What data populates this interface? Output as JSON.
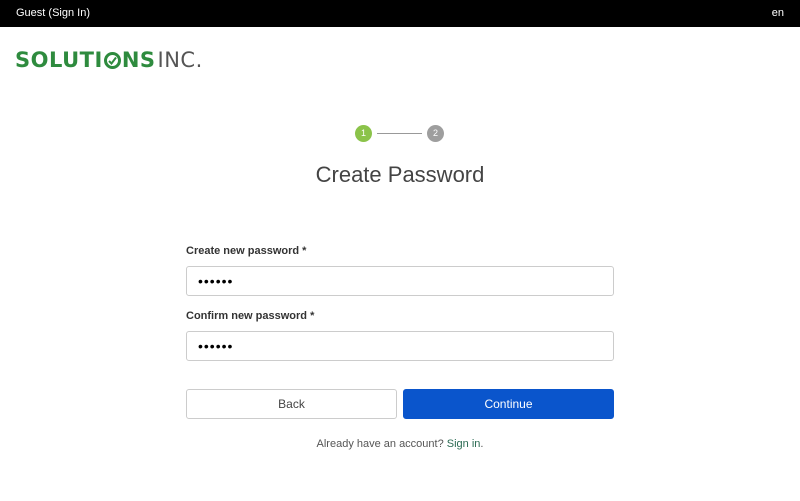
{
  "topbar": {
    "user": "Guest (Sign In)",
    "language": "en"
  },
  "logo": {
    "brand_left": "SOLUTI",
    "brand_right": "NS",
    "inc": "INC.",
    "color": "#2e8b3e"
  },
  "stepper": {
    "step1": "1",
    "step2": "2",
    "active_color": "#8bc34a",
    "inactive_color": "#9e9e9e"
  },
  "page": {
    "title": "Create Password"
  },
  "form": {
    "new_password_label": "Create new password",
    "new_password_value": "••••••",
    "confirm_password_label": "Confirm new password",
    "confirm_password_value": "••••••",
    "required_marker": "*"
  },
  "actions": {
    "back_label": "Back",
    "continue_label": "Continue",
    "primary_color": "#0a55cc"
  },
  "footer": {
    "prompt": "Already have an account?",
    "signin_link": "Sign in",
    "period": "."
  }
}
